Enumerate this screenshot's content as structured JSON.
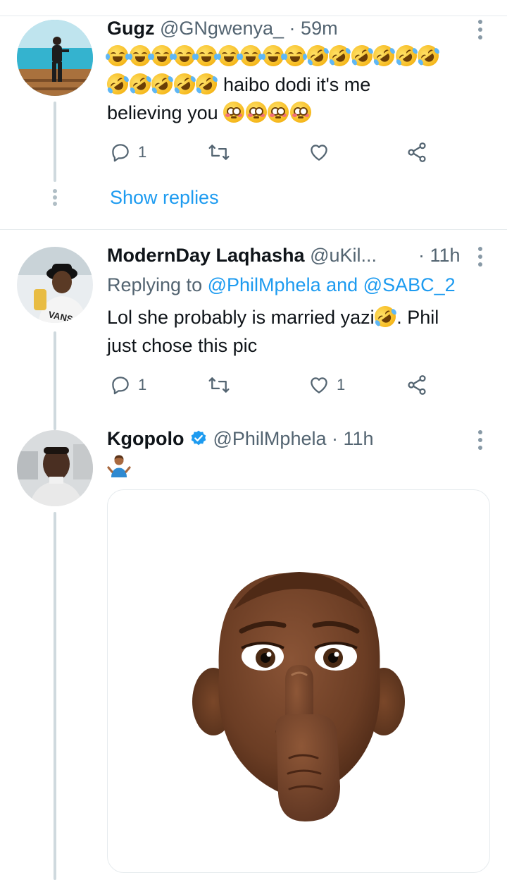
{
  "tweets": [
    {
      "name": "Gugz",
      "handle": "@GNgwenya_",
      "separator": "·",
      "time": "59m",
      "text_after_emoji": " haibo dodi it's me",
      "text_line3": "believing you",
      "reply_count": "1",
      "show_replies": "Show replies"
    },
    {
      "name": "ModernDay Laqhasha",
      "handle": "@uKil...",
      "separator": "·",
      "time": "11h",
      "replying_prefix": "Replying to ",
      "mention_1": "@PhilMphela",
      "mention_joiner": " and ",
      "mention_2": "@SABC_2",
      "text_part1": "Lol she probably is married yazi",
      "text_part2": ". Phil",
      "text_line2": "just chose this pic",
      "reply_count": "1",
      "like_count": "1"
    },
    {
      "name": "Kgopolo",
      "handle": "@PhilMphela",
      "separator": "·",
      "time": "11h",
      "verified": true,
      "emoji": "person-shrugging",
      "media": "memoji-shushing-face"
    }
  ],
  "colors": {
    "link": "#1d9bf0",
    "secondary_text": "#536471",
    "divider": "#e6ebee",
    "thread_line": "#cfd9de",
    "verified": "#1d9bf0"
  }
}
